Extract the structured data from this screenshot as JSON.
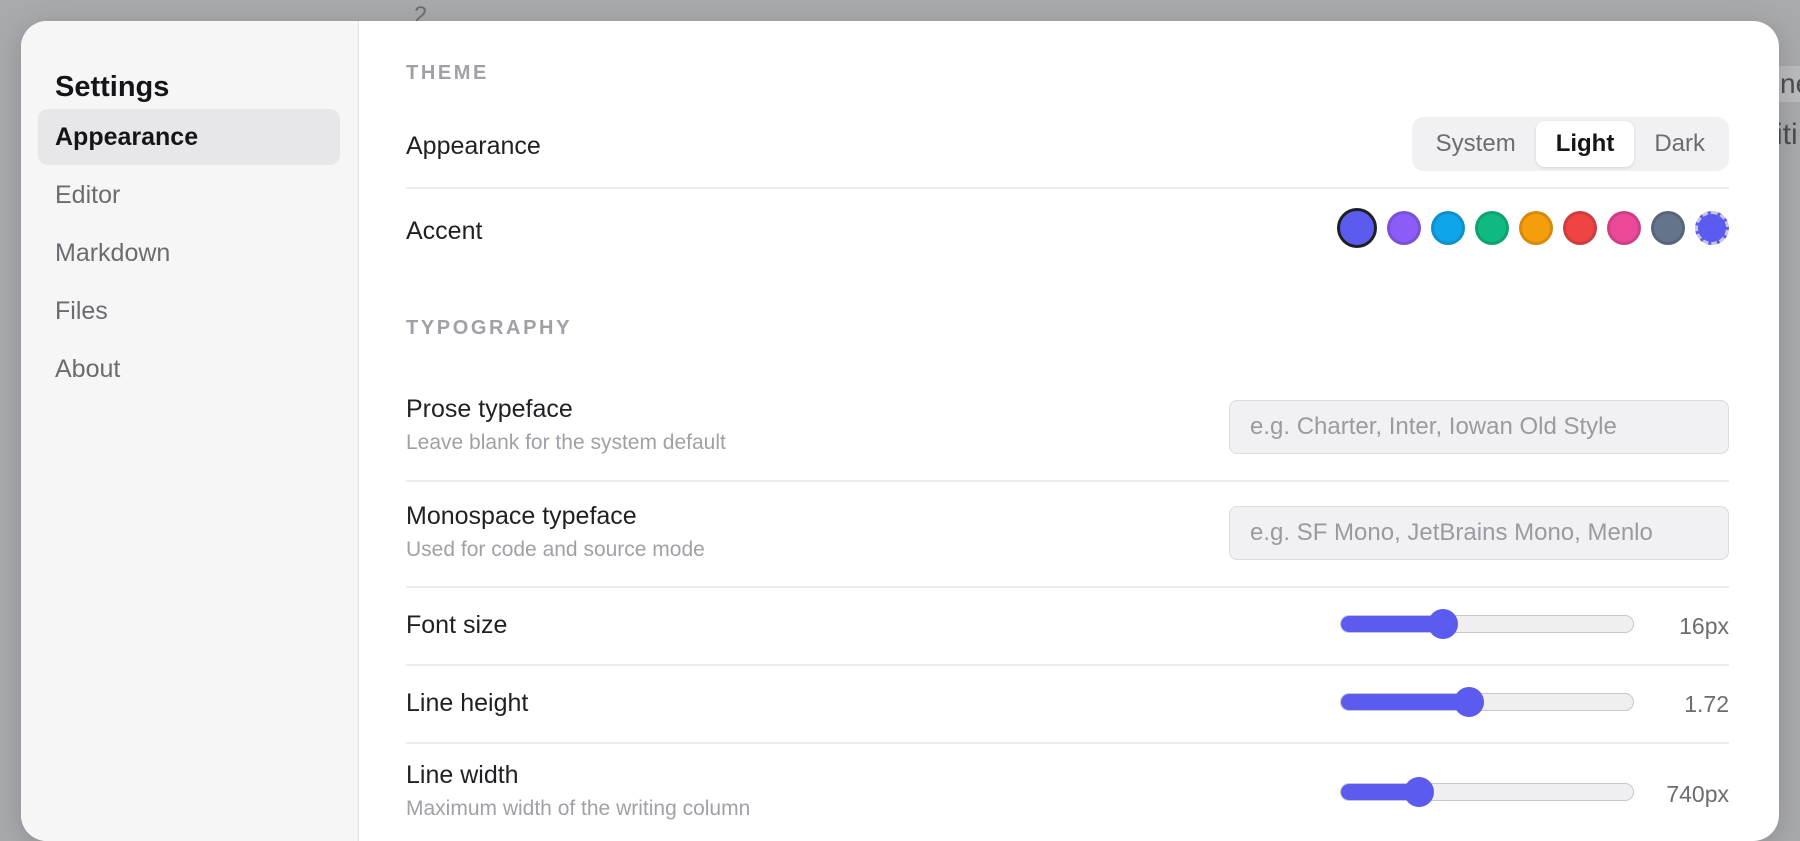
{
  "background": {
    "line_number": "2",
    "snippet_1": "ne",
    "snippet_2": "iti"
  },
  "sidebar": {
    "title": "Settings",
    "items": [
      {
        "label": "Appearance",
        "active": true
      },
      {
        "label": "Editor",
        "active": false
      },
      {
        "label": "Markdown",
        "active": false
      },
      {
        "label": "Files",
        "active": false
      },
      {
        "label": "About",
        "active": false
      }
    ]
  },
  "theme": {
    "heading": "THEME",
    "appearance": {
      "label": "Appearance",
      "options": [
        "System",
        "Light",
        "Dark"
      ],
      "selected": "Light"
    },
    "accent": {
      "label": "Accent",
      "swatches": [
        {
          "name": "indigo",
          "color": "#5b5bf0",
          "selected": true
        },
        {
          "name": "violet",
          "color": "#8b5cf6"
        },
        {
          "name": "sky",
          "color": "#0ea5e9"
        },
        {
          "name": "emerald",
          "color": "#10b981"
        },
        {
          "name": "amber",
          "color": "#f59e0b"
        },
        {
          "name": "red",
          "color": "#ef4444"
        },
        {
          "name": "pink",
          "color": "#ec4899"
        },
        {
          "name": "slate",
          "color": "#64748b"
        },
        {
          "name": "custom",
          "color": "#5b5bf0",
          "custom": true
        }
      ]
    }
  },
  "typography": {
    "heading": "TYPOGRAPHY",
    "prose": {
      "label": "Prose typeface",
      "sub": "Leave blank for the system default",
      "value": "",
      "placeholder": "e.g. Charter, Inter, Iowan Old Style"
    },
    "mono": {
      "label": "Monospace typeface",
      "sub": "Used for code and source mode",
      "value": "",
      "placeholder": "e.g. SF Mono, JetBrains Mono, Menlo"
    },
    "font_size": {
      "label": "Font size",
      "value_text": "16px",
      "fraction": 0.35
    },
    "line_height": {
      "label": "Line height",
      "value_text": "1.72",
      "fraction": 0.44
    },
    "line_width": {
      "label": "Line width",
      "sub": "Maximum width of the writing column",
      "value_text": "740px",
      "fraction": 0.27
    }
  },
  "colors": {
    "accent": "#5b5bf0"
  }
}
